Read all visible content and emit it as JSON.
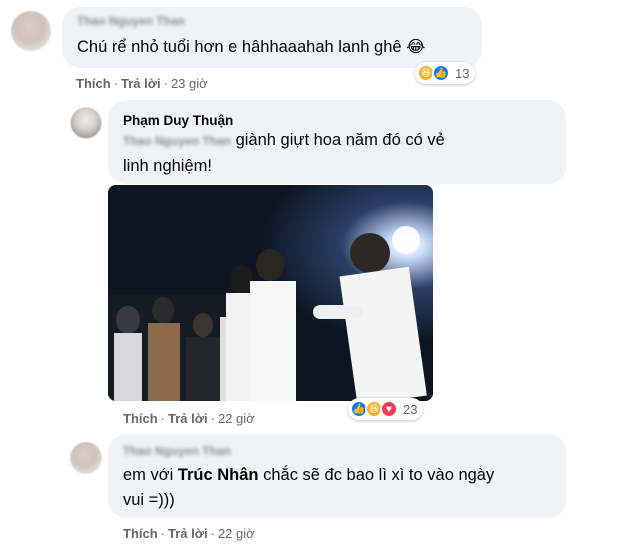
{
  "comments": [
    {
      "author": "Thao Nguyen Than",
      "text": "Chú rể nhỏ tuổi hơn e hâhhaaahah lanh ghê 😂",
      "actions": {
        "like": "Thích",
        "reply": "Trả lời",
        "time": "23 giờ"
      },
      "reactions": {
        "count": "13",
        "types": [
          "haha-icon",
          "like-icon"
        ]
      }
    },
    {
      "author": "Phạm Duy Thuận",
      "mention": "Thao Nguyen Than",
      "text_line1": "giành giựt hoa năm đó có vẻ",
      "text_line2": "linh nghiệm!",
      "actions": {
        "like": "Thích",
        "reply": "Trả lời",
        "time": "22 giờ"
      },
      "reactions": {
        "count": "23",
        "types": [
          "like-icon",
          "haha-icon",
          "love-icon"
        ]
      },
      "photo_caption": "wedding photo"
    },
    {
      "author": "Thao Nguyen Than",
      "text_before": "em với ",
      "text_bold": "Trúc Nhân",
      "text_after": " chắc sẽ đc bao lì xì to vào ngày",
      "text_line2": "vui =)))",
      "actions": {
        "like": "Thích",
        "reply": "Trả lời",
        "time": "22 giờ"
      }
    }
  ],
  "colors": {
    "bubble": "#f0f2f5",
    "meta": "#65676b",
    "like": "#1877f2",
    "haha": "#f7b125",
    "love": "#f33e58"
  }
}
